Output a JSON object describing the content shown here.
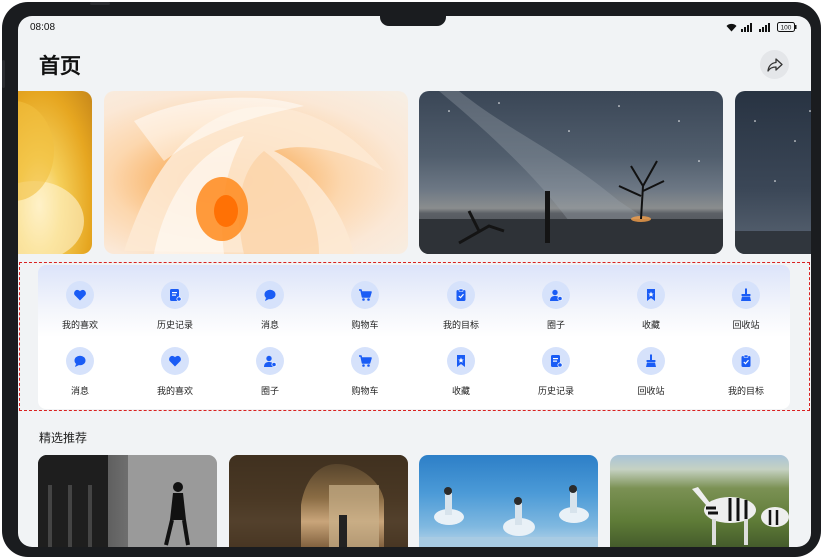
{
  "status_bar": {
    "time": "08:08",
    "battery": "100"
  },
  "header": {
    "title": "首页"
  },
  "banners": [
    {
      "name": "golden-abstract"
    },
    {
      "name": "orange-flower"
    },
    {
      "name": "milky-way-lake"
    },
    {
      "name": "night-sky"
    }
  ],
  "grid": {
    "row1": [
      {
        "label": "我的喜欢",
        "icon": "heart-icon"
      },
      {
        "label": "历史记录",
        "icon": "history-icon"
      },
      {
        "label": "消息",
        "icon": "message-icon"
      },
      {
        "label": "购物车",
        "icon": "cart-icon"
      },
      {
        "label": "我的目标",
        "icon": "goal-icon"
      },
      {
        "label": "圈子",
        "icon": "circle-icon"
      },
      {
        "label": "收藏",
        "icon": "bookmark-icon"
      },
      {
        "label": "回收站",
        "icon": "recycle-icon"
      }
    ],
    "row2": [
      {
        "label": "消息",
        "icon": "message-icon"
      },
      {
        "label": "我的喜欢",
        "icon": "heart-icon"
      },
      {
        "label": "圈子",
        "icon": "circle-icon"
      },
      {
        "label": "购物车",
        "icon": "cart-icon"
      },
      {
        "label": "收藏",
        "icon": "bookmark-icon"
      },
      {
        "label": "历史记录",
        "icon": "history-icon"
      },
      {
        "label": "回收站",
        "icon": "recycle-icon"
      },
      {
        "label": "我的目标",
        "icon": "goal-icon"
      }
    ]
  },
  "recommend": {
    "title": "精选推荐",
    "cards": [
      {
        "name": "street-photo"
      },
      {
        "name": "stone-arch"
      },
      {
        "name": "ballet-dancers"
      },
      {
        "name": "zebras"
      }
    ]
  },
  "colors": {
    "accent": "#1a5cf5",
    "icon_bg": "#d6e2fb",
    "highlight": "#d9201f"
  }
}
